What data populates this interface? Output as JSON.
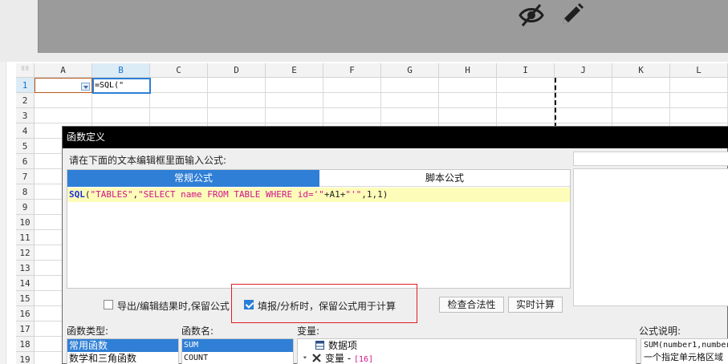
{
  "toolbar": {
    "icons": [
      "eye-slash-icon",
      "pencil-icon"
    ]
  },
  "sheet": {
    "columns": [
      "A",
      "B",
      "C",
      "D",
      "E",
      "F",
      "G",
      "H",
      "I",
      "J",
      "K",
      "L"
    ],
    "selected_column": "B",
    "rows": [
      "1",
      "2",
      "3",
      "4",
      "5",
      "6",
      "7",
      "8",
      "9",
      "10",
      "11",
      "12",
      "13",
      "14",
      "15",
      "16",
      "17",
      "18",
      "19"
    ],
    "selected_row": "1",
    "cell_b1": "=SQL(\""
  },
  "dialog": {
    "title": "函数定义",
    "prompt": "请在下面的文本编辑框里面输入公式:",
    "tabs": {
      "normal": "常规公式",
      "script": "脚本公式"
    },
    "formula": {
      "fn": "SQL",
      "p1": "(",
      "s1": "\"TABLES\"",
      "p2": ",",
      "s2": "\"SELECT name FROM TABLE WHERE id='\"",
      "p3": "+A1+",
      "s3": "\"'\"",
      "p4": ",1,1)"
    },
    "checkbox_export": {
      "label": "导出/编辑结果时,保留公式",
      "checked": false
    },
    "checkbox_fill": {
      "label": "填报/分析时，保留公式用于计算",
      "checked": true
    },
    "buttons": {
      "validate": "检查合法性",
      "compute": "实时计算"
    },
    "sections": {
      "function_type": "函数类型:",
      "function_name": "函数名:",
      "variable": "变量:",
      "description": "公式说明:"
    },
    "function_types": [
      {
        "label": "常用函数",
        "selected": true
      },
      {
        "label": "数学和三角函数",
        "selected": false
      }
    ],
    "function_names": [
      {
        "label": "SUM",
        "selected": true
      },
      {
        "label": "COUNT",
        "selected": false
      }
    ],
    "variables": {
      "data_item": "数据项",
      "var_label": "变量 - ",
      "var_count": "[16]"
    },
    "description_text": [
      "SUM(number1,number",
      "一个指定单元格区域"
    ]
  }
}
